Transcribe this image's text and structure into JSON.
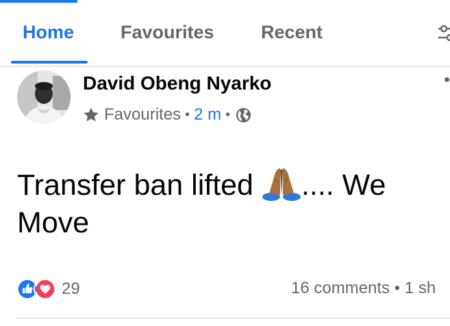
{
  "tabs": [
    {
      "label": "Home",
      "active": true
    },
    {
      "label": "Favourites",
      "active": false
    },
    {
      "label": "Recent",
      "active": false
    }
  ],
  "post": {
    "author": "David Obeng Nyarko",
    "audience": "Favourites",
    "time": "2 m",
    "privacy_icon": "globe-icon",
    "text_before": "Transfer ban lifted ",
    "emoji": "folded-hands-icon",
    "text_after": ".... We Move",
    "reactions": {
      "icons": [
        "like-icon",
        "love-icon"
      ],
      "count": "29"
    },
    "stats": "16 comments • 1 sh"
  },
  "colors": {
    "accent": "#1877f2",
    "muted": "#65676b",
    "love": "#f33e58"
  }
}
